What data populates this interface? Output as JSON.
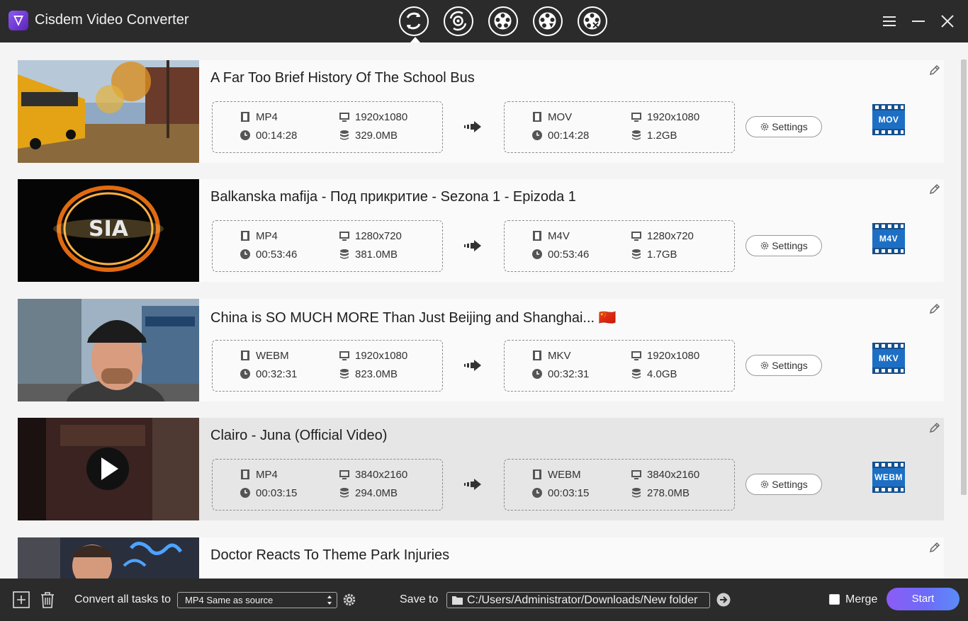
{
  "app": {
    "title": "Cisdem Video Converter"
  },
  "toolbar": {
    "tools": [
      {
        "name": "convert",
        "active": true
      },
      {
        "name": "rip-dvd"
      },
      {
        "name": "merge-video"
      },
      {
        "name": "download-video"
      },
      {
        "name": "compress-video"
      }
    ]
  },
  "tasks": [
    {
      "title": "A Far Too Brief History Of The School Bus",
      "source": {
        "format": "MP4",
        "resolution": "1920x1080",
        "duration": "00:14:28",
        "size": "329.0MB"
      },
      "target": {
        "format": "MOV",
        "resolution": "1920x1080",
        "duration": "00:14:28",
        "size": "1.2GB"
      },
      "settings_label": "Settings",
      "badge": "MOV",
      "thumbnail": "school-bus-autumn-street"
    },
    {
      "title": "Balkanska mafija - Под прикритие - Sezona 1 - Epizoda 1",
      "source": {
        "format": "MP4",
        "resolution": "1280x720",
        "duration": "00:53:46",
        "size": "381.0MB"
      },
      "target": {
        "format": "M4V",
        "resolution": "1280x720",
        "duration": "00:53:46",
        "size": "1.7GB"
      },
      "settings_label": "Settings",
      "badge": "M4V",
      "thumbnail": "sia-logo-ring",
      "logo_text": "SIA"
    },
    {
      "title": "China is SO MUCH MORE Than Just Beijing and Shanghai... 🇨🇳",
      "source": {
        "format": "WEBM",
        "resolution": "1920x1080",
        "duration": "00:32:31",
        "size": "823.0MB"
      },
      "target": {
        "format": "MKV",
        "resolution": "1920x1080",
        "duration": "00:32:31",
        "size": "4.0GB"
      },
      "settings_label": "Settings",
      "badge": "MKV",
      "thumbnail": "man-in-cap-street"
    },
    {
      "title": "Clairo - Juna (Official Video)",
      "source": {
        "format": "MP4",
        "resolution": "3840x2160",
        "duration": "00:03:15",
        "size": "294.0MB"
      },
      "target": {
        "format": "WEBM",
        "resolution": "3840x2160",
        "duration": "00:03:15",
        "size": "278.0MB"
      },
      "settings_label": "Settings",
      "badge": "WEBM",
      "thumbnail": "dark-room-play",
      "selected": true
    },
    {
      "title": "Doctor Reacts To Theme Park Injuries",
      "thumbnail": "doctor-neon-sign"
    }
  ],
  "bottom": {
    "convert_all_label": "Convert all tasks to",
    "convert_all_value": "MP4 Same as source",
    "save_to_label": "Save to",
    "save_path": "C:/Users/Administrator/Downloads/New folder",
    "merge_label": "Merge",
    "merge_checked": false,
    "start_label": "Start"
  },
  "colors": {
    "chrome": "#2b2b2b",
    "list_bg": "#f4f4f4",
    "row_bg": "#fafafa",
    "row_selected": "#e6e6e6",
    "badge_blue": "#1d6fc4",
    "start_gradient": [
      "#8b5cf6",
      "#5b8cf8"
    ]
  }
}
